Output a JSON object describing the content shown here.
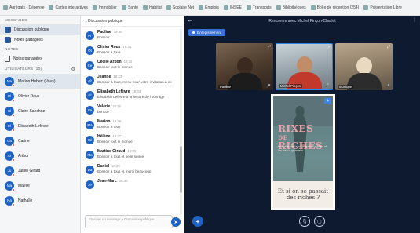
{
  "bookmarks": [
    "Agrégats - Dépense",
    "Cartes interactives",
    "Immobilier",
    "Santé",
    "Habitat",
    "Scolaire Net",
    "Emplois",
    "INSEE",
    "Transports",
    "Bibliothèques",
    "Boîte de réception (254)",
    "Présentation Libre"
  ],
  "left": {
    "section_messages": "MESSAGES",
    "messages_items": [
      {
        "label": "Discussion publique",
        "active": true
      },
      {
        "label": "Notes partagées",
        "active": false
      }
    ],
    "section_notes": "NOTES",
    "notes_items": [
      {
        "label": "Notes partagées"
      }
    ],
    "section_users": "UTILISATEURS (10)",
    "users": [
      {
        "initials": "Ma",
        "name": "Marion Hubert (Vous)"
      },
      {
        "initials": "Ol",
        "name": "Olivier Roux"
      },
      {
        "initials": "Cl",
        "name": "Claire Sanchez"
      },
      {
        "initials": "Él",
        "name": "Élisabeth Lefèvre"
      },
      {
        "initials": "Ca",
        "name": "Carine"
      },
      {
        "initials": "Ar",
        "name": "Arthur"
      },
      {
        "initials": "Ju",
        "name": "Julien Girard"
      },
      {
        "initials": "Ma",
        "name": "Maëlle"
      },
      {
        "initials": "Na",
        "name": "Nathalie"
      }
    ]
  },
  "chat": {
    "header": "‹  Discussion publique",
    "messages": [
      {
        "initials": "Pr",
        "name": "Pauline",
        "time": "18:30",
        "text": "Bonsoir"
      },
      {
        "initials": "Ol",
        "name": "Olivier Roux",
        "time": "18:31",
        "text": "Bonsoir à tous"
      },
      {
        "initials": "Cé",
        "name": "Cécile Arbon",
        "time": "18:32",
        "text": "Bonsoir tout le monde"
      },
      {
        "initials": "Je",
        "name": "Jeanne",
        "time": "18:33",
        "text": "Bonjour à tous, merci pour votre invitation à ce"
      },
      {
        "initials": "Él",
        "name": "Élisabeth Lefèvre",
        "time": "18:34",
        "text": "Élisabeth Lefèvre à la lecture de l'ouvrage"
      },
      {
        "initials": "Va",
        "name": "Valérie",
        "time": "18:35",
        "text": "bonsoir"
      },
      {
        "initials": "Ma",
        "name": "Marion",
        "time": "18:36",
        "text": "Bonsoir à tous"
      },
      {
        "initials": "Hé",
        "name": "Hélène",
        "time": "18:37",
        "text": "Bonsoir tout le monde"
      },
      {
        "initials": "Ma",
        "name": "Martine Giraud",
        "time": "18:38",
        "text": "Bonsoir à tous et belle soirée"
      },
      {
        "initials": "Da",
        "name": "Daniel",
        "time": "18:39",
        "text": "Bonsoir à tous et merci beaucoup"
      },
      {
        "initials": "Je",
        "name": "Jean-Marc",
        "time": "18:40",
        "text": ""
      }
    ],
    "input_placeholder": "Envoyer un message à Discussion publique"
  },
  "main": {
    "title": "Rencontre avec Michel Pinçon-Charlot",
    "recording_label": "Enregistrement",
    "videos": [
      {
        "name": "Pauline",
        "mic": "🎤"
      },
      {
        "name": "Michel Pinçon",
        "mic": "🎤"
      },
      {
        "name": "Monique",
        "mic": "🎤"
      }
    ],
    "presentation": {
      "title_line1": "RIXES",
      "title_line2": "DE",
      "title_line3": "RICHES",
      "subtitle": "Enquête sur la ségrégation sociale et les beaux quartiers",
      "bottom_text": "Et si on se passait des riches ?",
      "plus_label": "+"
    },
    "controls": {
      "plus_label": "+",
      "mic_label": "🎙",
      "cam_label": "▢"
    }
  },
  "colors": {
    "accent": "#1f63c5",
    "dark_bg": "#0d1a30",
    "presentation_bg": "#5f7b7c",
    "title_pink": "#e6a2a8"
  }
}
